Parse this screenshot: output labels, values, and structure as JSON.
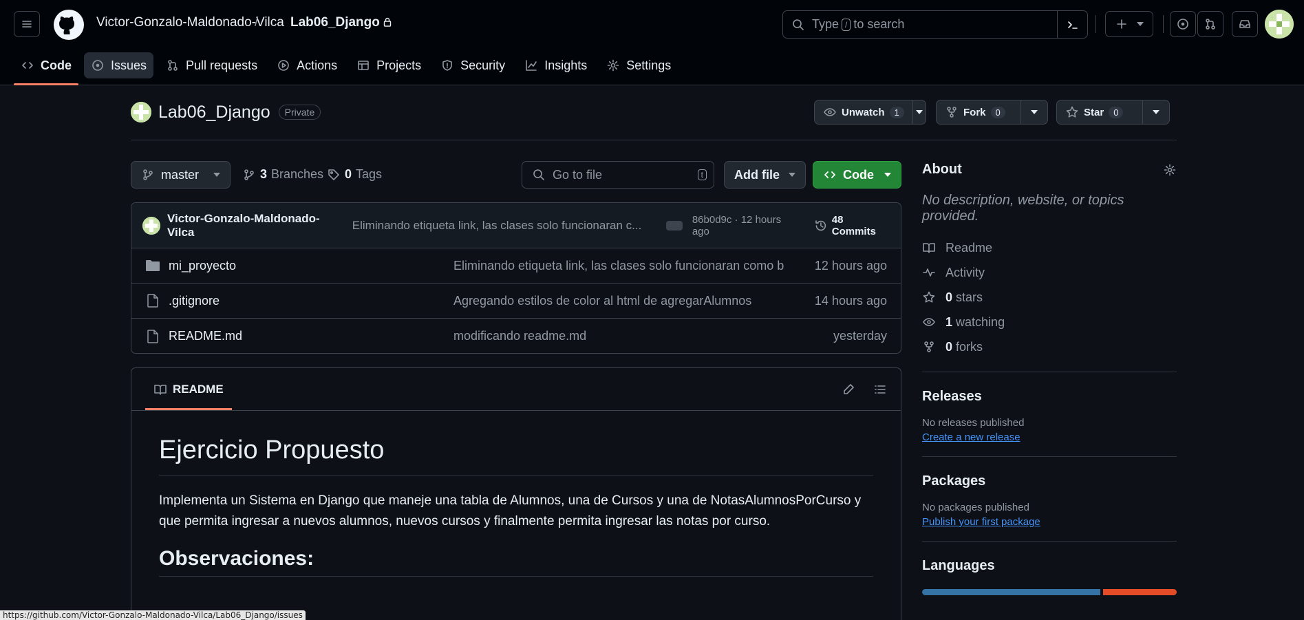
{
  "header": {
    "owner": "Victor-Gonzalo-Maldonado-Vilca",
    "separator": "/",
    "repo": "Lab06_Django",
    "search_prefix": "Type",
    "search_key": "/",
    "search_suffix": "to search"
  },
  "tabs": [
    {
      "label": "Code"
    },
    {
      "label": "Issues"
    },
    {
      "label": "Pull requests"
    },
    {
      "label": "Actions"
    },
    {
      "label": "Projects"
    },
    {
      "label": "Security"
    },
    {
      "label": "Insights"
    },
    {
      "label": "Settings"
    }
  ],
  "repo": {
    "name": "Lab06_Django",
    "visibility": "Private",
    "unwatch_label": "Unwatch",
    "unwatch_count": "1",
    "fork_label": "Fork",
    "fork_count": "0",
    "star_label": "Star",
    "star_count": "0"
  },
  "branchbar": {
    "branch": "master",
    "branches_count": "3",
    "branches_label": "Branches",
    "tags_count": "0",
    "tags_label": "Tags",
    "goto_placeholder": "Go to file",
    "goto_key": "t",
    "add_file": "Add file",
    "code": "Code"
  },
  "latest_commit": {
    "author": "Victor-Gonzalo-Maldonado-Vilca",
    "message": "Eliminando etiqueta link, las clases solo funcionaran c...",
    "hash_time": "86b0d9c · 12 hours ago",
    "commits": "48 Commits"
  },
  "files": [
    {
      "name": "mi_proyecto",
      "type": "folder",
      "message": "Eliminando etiqueta link, las clases solo funcionaran como b...",
      "time": "12 hours ago"
    },
    {
      "name": ".gitignore",
      "type": "file",
      "message": "Agregando estilos de color al html de agregarAlumnos",
      "time": "14 hours ago"
    },
    {
      "name": "README.md",
      "type": "file",
      "message": "modificando readme.md",
      "time": "yesterday"
    }
  ],
  "readme": {
    "tab": "README",
    "h1": "Ejercicio Propuesto",
    "paragraph": "Implementa un Sistema en Django que maneje una tabla de Alumnos, una de Cursos y una de NotasAlumnosPorCurso y que permita ingresar a nuevos alumnos, nuevos cursos y finalmente permita ingresar las notas por curso.",
    "h2": "Observaciones:"
  },
  "about": {
    "title": "About",
    "description": "No description, website, or topics provided.",
    "items": [
      {
        "icon": "book-icon",
        "count": "",
        "label": "Readme"
      },
      {
        "icon": "pulse-icon",
        "count": "",
        "label": "Activity"
      },
      {
        "icon": "star-icon",
        "count": "0",
        "label": "stars"
      },
      {
        "icon": "eye-icon",
        "count": "1",
        "label": "watching"
      },
      {
        "icon": "fork-icon",
        "count": "0",
        "label": "forks"
      }
    ]
  },
  "releases": {
    "title": "Releases",
    "empty": "No releases published",
    "link": "Create a new release"
  },
  "packages": {
    "title": "Packages",
    "empty": "No packages published",
    "link": "Publish your first package"
  },
  "languages": {
    "title": "Languages",
    "colors": {
      "python": "#3572A5",
      "html": "#e34c26"
    }
  },
  "statusbar": {
    "url": "https://github.com/Victor-Gonzalo-Maldonado-Vilca/Lab06_Django/issues"
  }
}
